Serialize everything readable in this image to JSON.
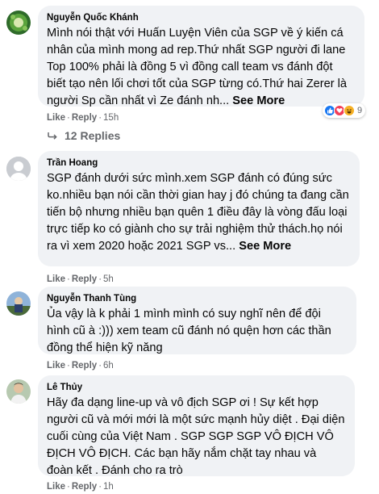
{
  "comments": [
    {
      "author": "Nguyễn Quốc Khánh",
      "text": "Mình nói thật với Huấn Luyện Viên của SGP về ý kiến cá nhân của mình mong ad rep.Thứ nhất SGP người đi lane Top 100% phải là đồng 5 vì đồng call team vs đánh đột biết tạo nên lối chơi tốt của SGP từng có.Thứ hai Zerer là người Sp cần nhất vì Ze đánh nh...",
      "see_more": "See More",
      "like": "Like",
      "reply": "Reply",
      "time": "15h",
      "reactions_count": "9",
      "reaction_icons": [
        "like-reaction-icon",
        "love-reaction-icon",
        "haha-reaction-icon"
      ],
      "replies_label": "12 Replies"
    },
    {
      "author": "Trần Hoang",
      "text": "SGP đánh dưới sức mình.xem SGP đánh có đúng sức ko.nhiều bạn nói cần thời gian hay j đó chúng ta đang cần tiến bộ nhưng nhiều bạn quên 1 điều đây là vòng đấu loại trực tiếp ko có giành cho sự trải nghiệm thử thách.họ nói ra vì xem 2020 hoặc 2021 SGP vs...",
      "see_more": "See More",
      "like": "Like",
      "reply": "Reply",
      "time": "5h"
    },
    {
      "author": "Nguyễn Thanh Tùng",
      "text": "Ủa vậy là k phải 1 mình mình có suy nghĩ nên để đội hình cũ à :))) xem team cũ đánh nó quện hơn các thần đồng thể hiện kỹ năng",
      "like": "Like",
      "reply": "Reply",
      "time": "6h"
    },
    {
      "author": "Lê Thủy",
      "text": "Hãy đa dạng line-up và vô địch SGP ơi ! Sự kết hợp người cũ và mới mới là một sức mạnh hủy diệt . Đại diện cuối cùng của Việt Nam . SGP SGP SGP VÔ ĐỊCH VÔ ĐỊCH VÔ ĐỊCH. Các bạn hãy nắm chặt tay nhau và đoàn kết . Đánh cho ra trò",
      "like": "Like",
      "reply": "Reply",
      "time": "1h"
    }
  ],
  "colors": {
    "bubble": "#f0f2f5",
    "secondary_text": "#65676b",
    "like_blue": "#1877f2",
    "love_red": "#f33e58",
    "haha_yellow": "#f7b125"
  }
}
